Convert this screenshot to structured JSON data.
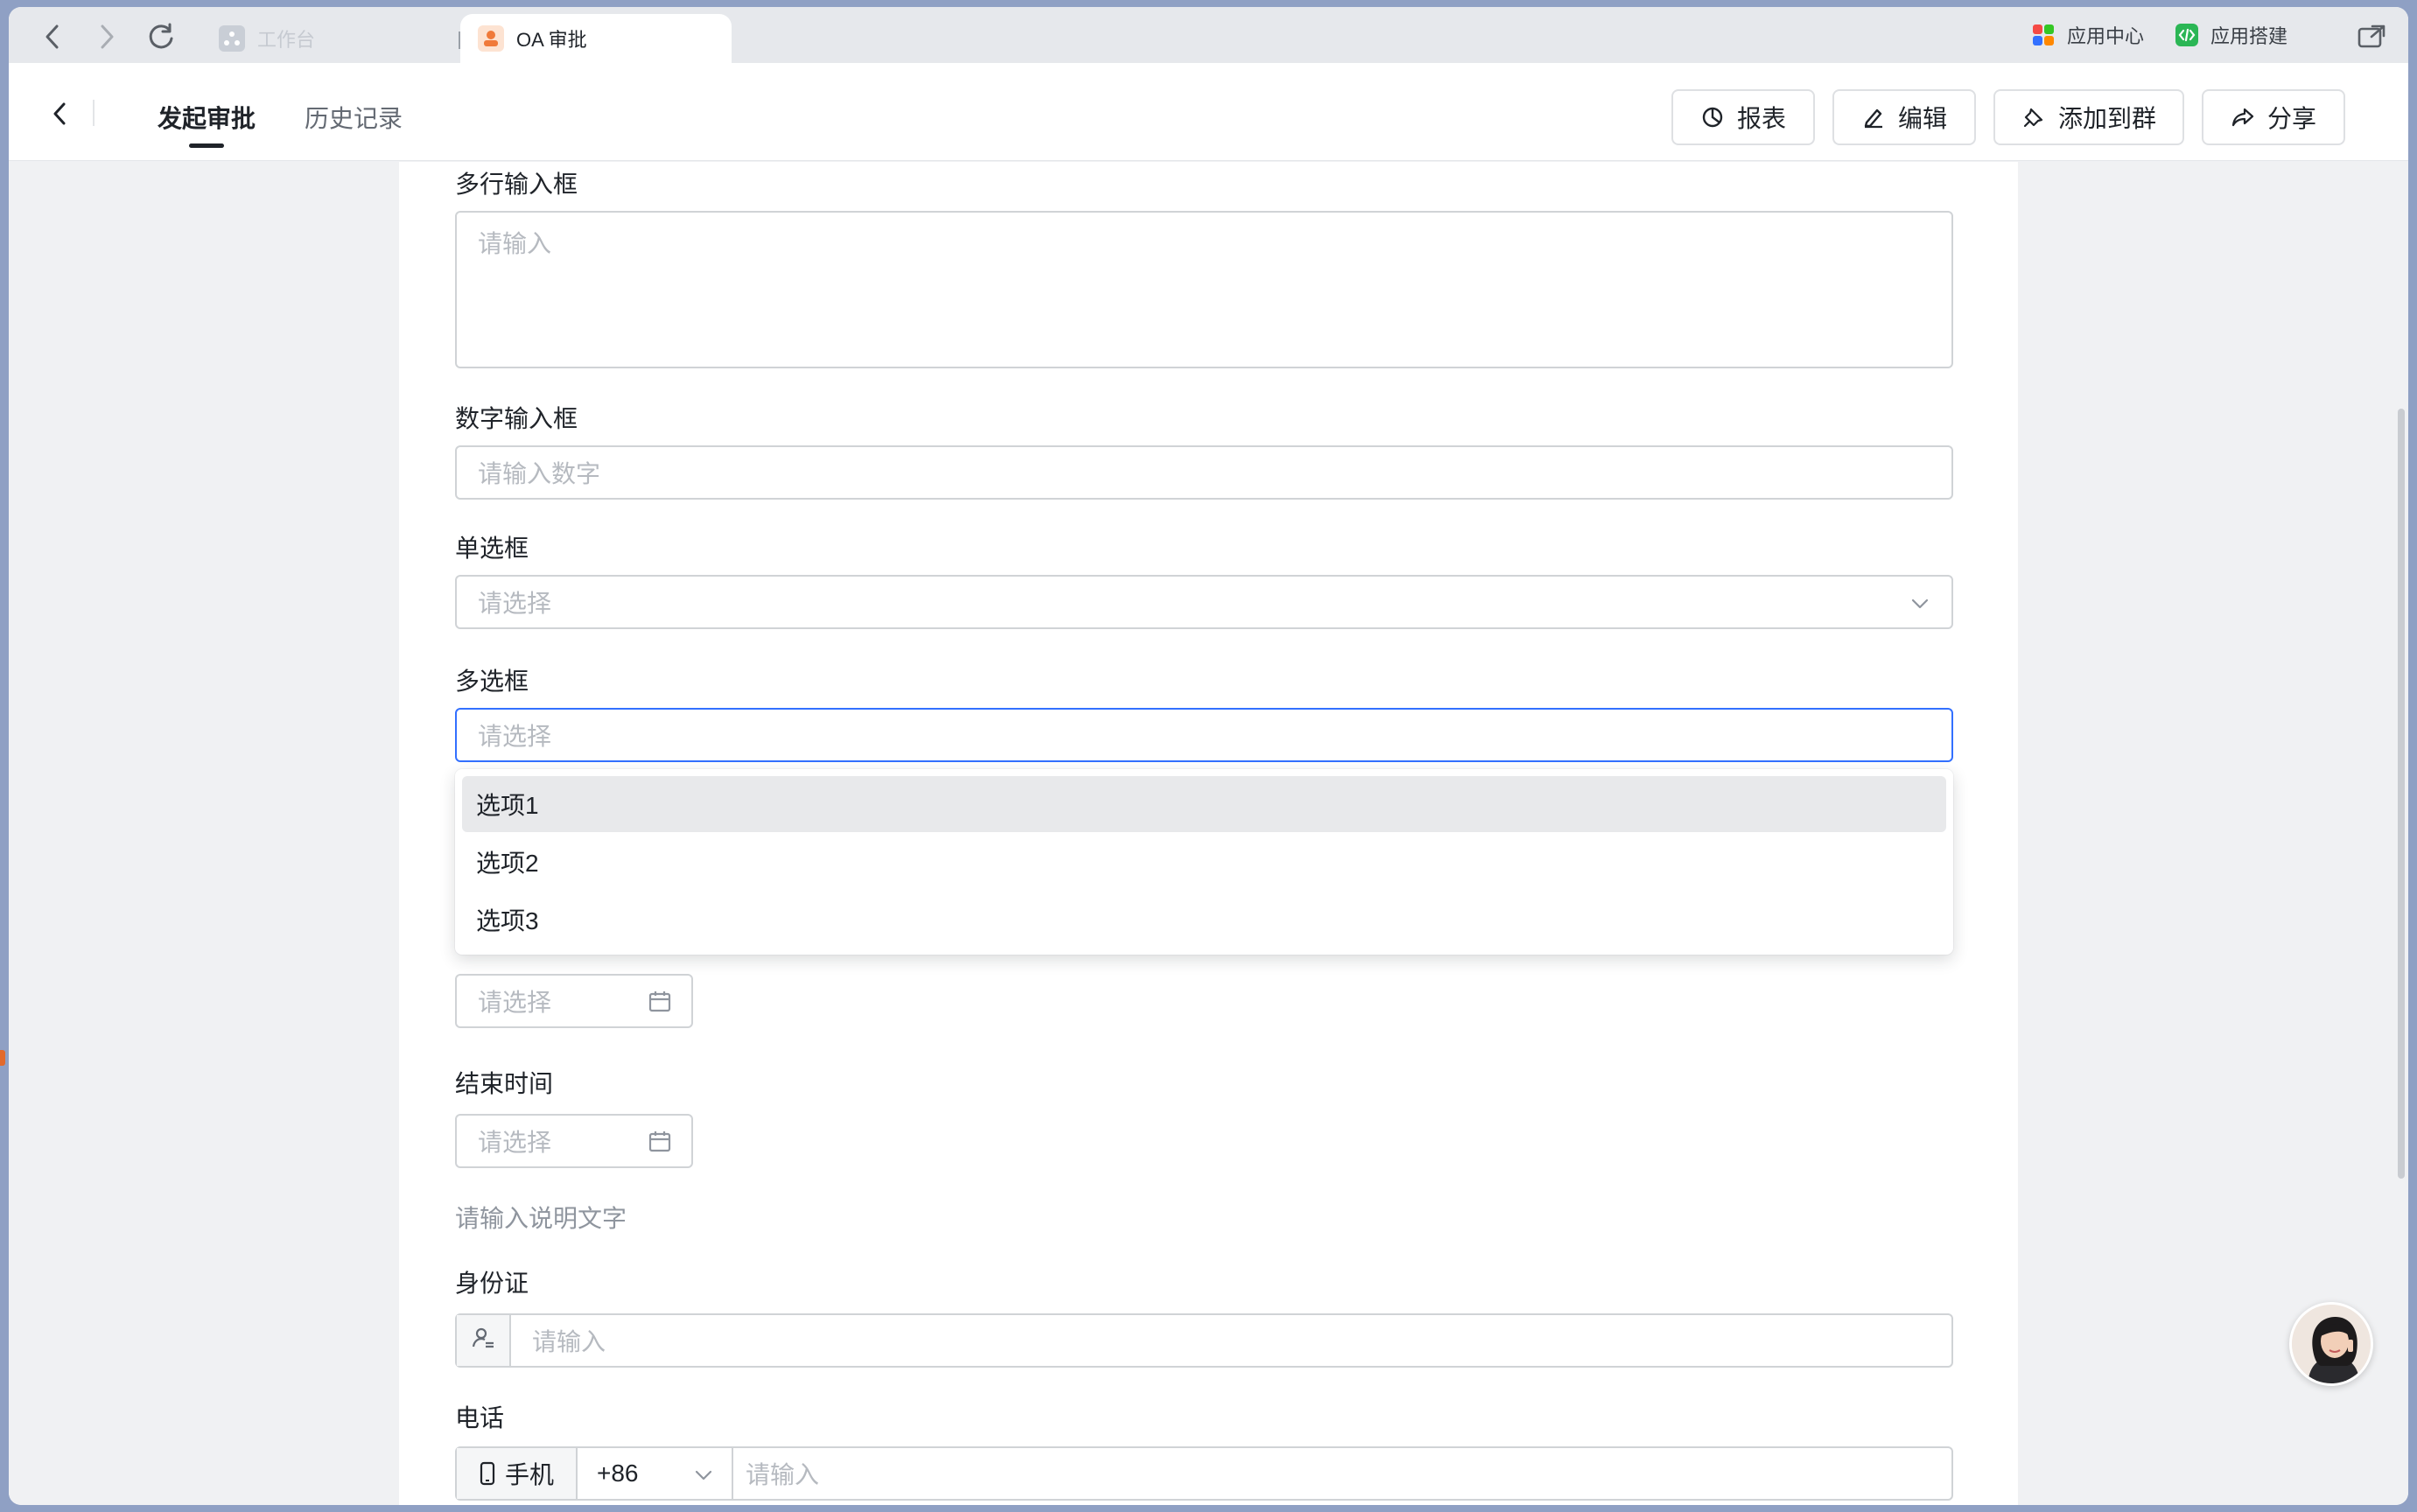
{
  "browser": {
    "tabs": [
      {
        "label": "工作台",
        "active": false
      },
      {
        "label": "OA 审批",
        "active": true
      }
    ],
    "top_right": [
      {
        "label": "应用中心",
        "icon": "app-center-icon"
      },
      {
        "label": "应用搭建",
        "icon": "app-builder-icon"
      }
    ]
  },
  "header": {
    "tabs": [
      {
        "label": "发起审批",
        "active": true
      },
      {
        "label": "历史记录",
        "active": false
      }
    ],
    "buttons": [
      {
        "label": "报表",
        "icon": "report-icon"
      },
      {
        "label": "编辑",
        "icon": "edit-icon"
      },
      {
        "label": "添加到群",
        "icon": "pin-icon"
      },
      {
        "label": "分享",
        "icon": "share-icon"
      }
    ]
  },
  "form": {
    "multiline": {
      "label": "多行输入框",
      "placeholder": "请输入"
    },
    "number": {
      "label": "数字输入框",
      "placeholder": "请输入数字"
    },
    "single_select": {
      "label": "单选框",
      "placeholder": "请选择"
    },
    "multi_select": {
      "label": "多选框",
      "placeholder": "请选择",
      "options": [
        "选项1",
        "选项2",
        "选项3"
      ]
    },
    "start_time": {
      "placeholder": "请选择"
    },
    "end_time": {
      "label": "结束时间",
      "placeholder": "请选择"
    },
    "description": "请输入说明文字",
    "id_card": {
      "label": "身份证",
      "placeholder": "请输入"
    },
    "phone": {
      "label": "电话",
      "type": "手机",
      "country_code": "+86",
      "placeholder": "请输入"
    }
  },
  "colors": {
    "accent": "#3370ff",
    "text": "#1f2329",
    "placeholder": "#b6bac0"
  }
}
